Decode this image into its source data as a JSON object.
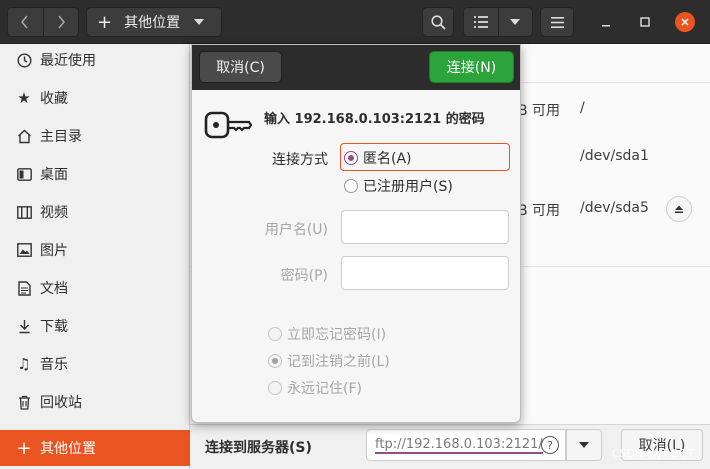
{
  "header": {
    "location_label": "其他位置",
    "icons": [
      "back-icon",
      "forward-icon",
      "plus-icon",
      "chevron-down-icon",
      "search-icon",
      "list-view-icon",
      "chevron-down-icon",
      "menu-icon",
      "minimize-icon",
      "maximize-icon",
      "close-icon"
    ]
  },
  "sidebar": {
    "items": [
      {
        "label": "最近使用",
        "icon": "clock-icon"
      },
      {
        "label": "收藏",
        "icon": "star-icon"
      },
      {
        "label": "主目录",
        "icon": "home-icon"
      },
      {
        "label": "桌面",
        "icon": "desktop-icon"
      },
      {
        "label": "视频",
        "icon": "video-icon"
      },
      {
        "label": "图片",
        "icon": "image-icon"
      },
      {
        "label": "文档",
        "icon": "document-icon"
      },
      {
        "label": "下载",
        "icon": "download-icon"
      },
      {
        "label": "音乐",
        "icon": "music-icon"
      },
      {
        "label": "回收站",
        "icon": "trash-icon"
      },
      {
        "label": "其他位置",
        "icon": "plus-icon",
        "active": true
      }
    ]
  },
  "main": {
    "rows": [
      {
        "size_suffix": "B 可用",
        "path": "/"
      },
      {
        "size_suffix": "",
        "path": "/dev/sda1"
      },
      {
        "size_suffix": "B 可用",
        "path": "/dev/sda5"
      }
    ]
  },
  "bottom": {
    "server_label": "连接到服务器(S)",
    "server_value": "ftp://192.168.0.103:2121/",
    "cancel_label": "取消(L)"
  },
  "dialog": {
    "cancel_label": "取消(C)",
    "connect_label": "连接(N)",
    "title": "输入 192.168.0.103:2121 的密码",
    "method_label": "连接方式",
    "anonymous_label": "匿名(A)",
    "registered_label": "已注册用户(S)",
    "username_label": "用户名(U)",
    "password_label": "密码(P)",
    "forget_now_label": "立即忘记密码(I)",
    "remember_logout_label": "记到注销之前(L)",
    "remember_forever_label": "永远记住(F)"
  },
  "watermark": "CSDN @JT BOT",
  "colors": {
    "accent": "#e95420",
    "connect": "#2da33c",
    "radio": "#924d8b"
  }
}
